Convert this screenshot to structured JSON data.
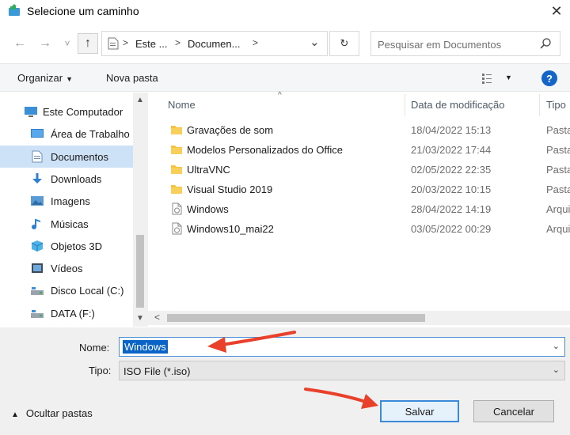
{
  "window": {
    "title": "Selecione um caminho",
    "close_glyph": "✕",
    "app_icon": "folder-save-icon"
  },
  "nav": {
    "back_glyph": "←",
    "forward_glyph": "→",
    "recent_glyph": "˅",
    "up_glyph": "↑"
  },
  "address": {
    "crumbs": [
      "Este ...",
      "Documen..."
    ],
    "separator": ">",
    "dropdown_glyph": "⌄",
    "refresh_glyph": "↻"
  },
  "search": {
    "placeholder": "Pesquisar em Documentos"
  },
  "toolbar": {
    "organize": "Organizar",
    "new_folder": "Nova pasta",
    "help": "?"
  },
  "sidebar": {
    "items": [
      {
        "label": "Este Computador",
        "icon": "computer-icon",
        "root": true
      },
      {
        "label": "Área de Trabalho",
        "icon": "desktop-icon"
      },
      {
        "label": "Documentos",
        "icon": "document-icon",
        "selected": true
      },
      {
        "label": "Downloads",
        "icon": "download-icon"
      },
      {
        "label": "Imagens",
        "icon": "image-icon"
      },
      {
        "label": "Músicas",
        "icon": "music-icon"
      },
      {
        "label": "Objetos 3D",
        "icon": "cube-icon"
      },
      {
        "label": "Vídeos",
        "icon": "video-icon"
      },
      {
        "label": "Disco Local (C:)",
        "icon": "drive-icon"
      },
      {
        "label": "DATA (F:)",
        "icon": "drive-icon"
      }
    ]
  },
  "files": {
    "columns": [
      "Nome",
      "Data de modificação",
      "Tipo"
    ],
    "rows": [
      {
        "name": "Gravações de som",
        "date": "18/04/2022 15:13",
        "type": "Pasta",
        "kind": "folder"
      },
      {
        "name": "Modelos Personalizados do Office",
        "date": "21/03/2022 17:44",
        "type": "Pasta",
        "kind": "folder"
      },
      {
        "name": "UltraVNC",
        "date": "02/05/2022 22:35",
        "type": "Pasta",
        "kind": "folder"
      },
      {
        "name": "Visual Studio 2019",
        "date": "20/03/2022 10:15",
        "type": "Pasta",
        "kind": "folder"
      },
      {
        "name": "Windows",
        "date": "28/04/2022 14:19",
        "type": "Arquivo",
        "kind": "file"
      },
      {
        "name": "Windows10_mai22",
        "date": "03/05/2022 00:29",
        "type": "Arquivo",
        "kind": "file"
      }
    ]
  },
  "form": {
    "name_label": "Nome:",
    "name_value": "Windows",
    "type_label": "Tipo:",
    "type_value": "ISO File (*.iso)",
    "hide_folders": "Ocultar pastas",
    "save": "Salvar",
    "cancel": "Cancelar"
  },
  "colors": {
    "accent": "#0a64c8",
    "selection": "#cde2f6",
    "annotation_arrow": "#e8402a",
    "folder": "#f5c242"
  }
}
